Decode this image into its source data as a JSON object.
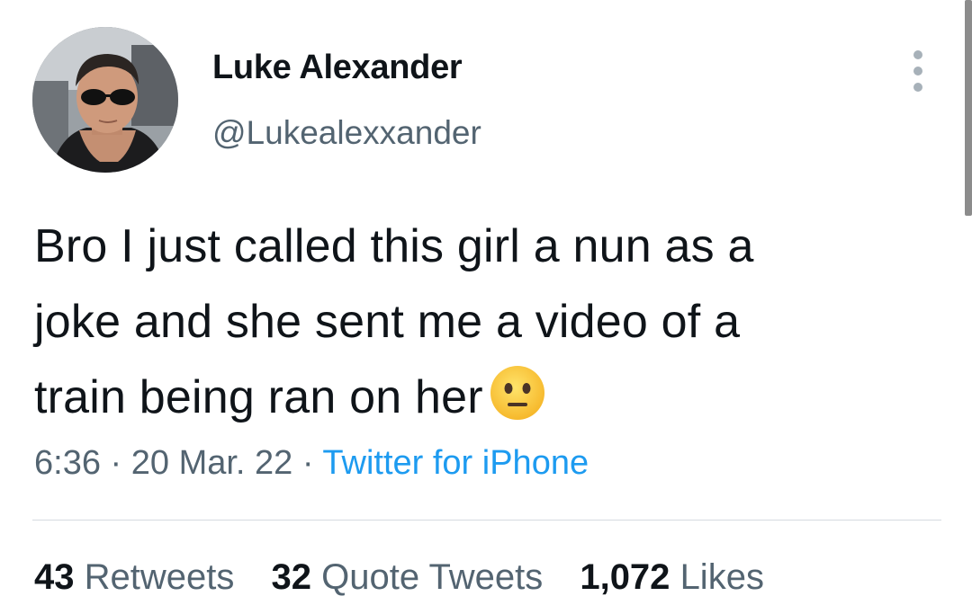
{
  "author": {
    "display_name": "Luke Alexander",
    "handle": "@Lukealexxander"
  },
  "tweet": {
    "text_line1": "Bro I just called this girl a nun as a",
    "text_line2": "joke and she sent me a video of a",
    "text_line3": "train being ran on her",
    "emoji": "neutral-face"
  },
  "meta": {
    "time": "6:36",
    "date": "20 Mar. 22",
    "separator": "·",
    "source": "Twitter for iPhone"
  },
  "stats": {
    "retweets_count": "43",
    "retweets_label": "Retweets",
    "quotes_count": "32",
    "quotes_label": "Quote Tweets",
    "likes_count": "1,072",
    "likes_label": "Likes"
  },
  "colors": {
    "text_primary": "#0f1419",
    "text_secondary": "#536471",
    "link": "#1d9bf0",
    "divider": "#d5dbe0"
  }
}
